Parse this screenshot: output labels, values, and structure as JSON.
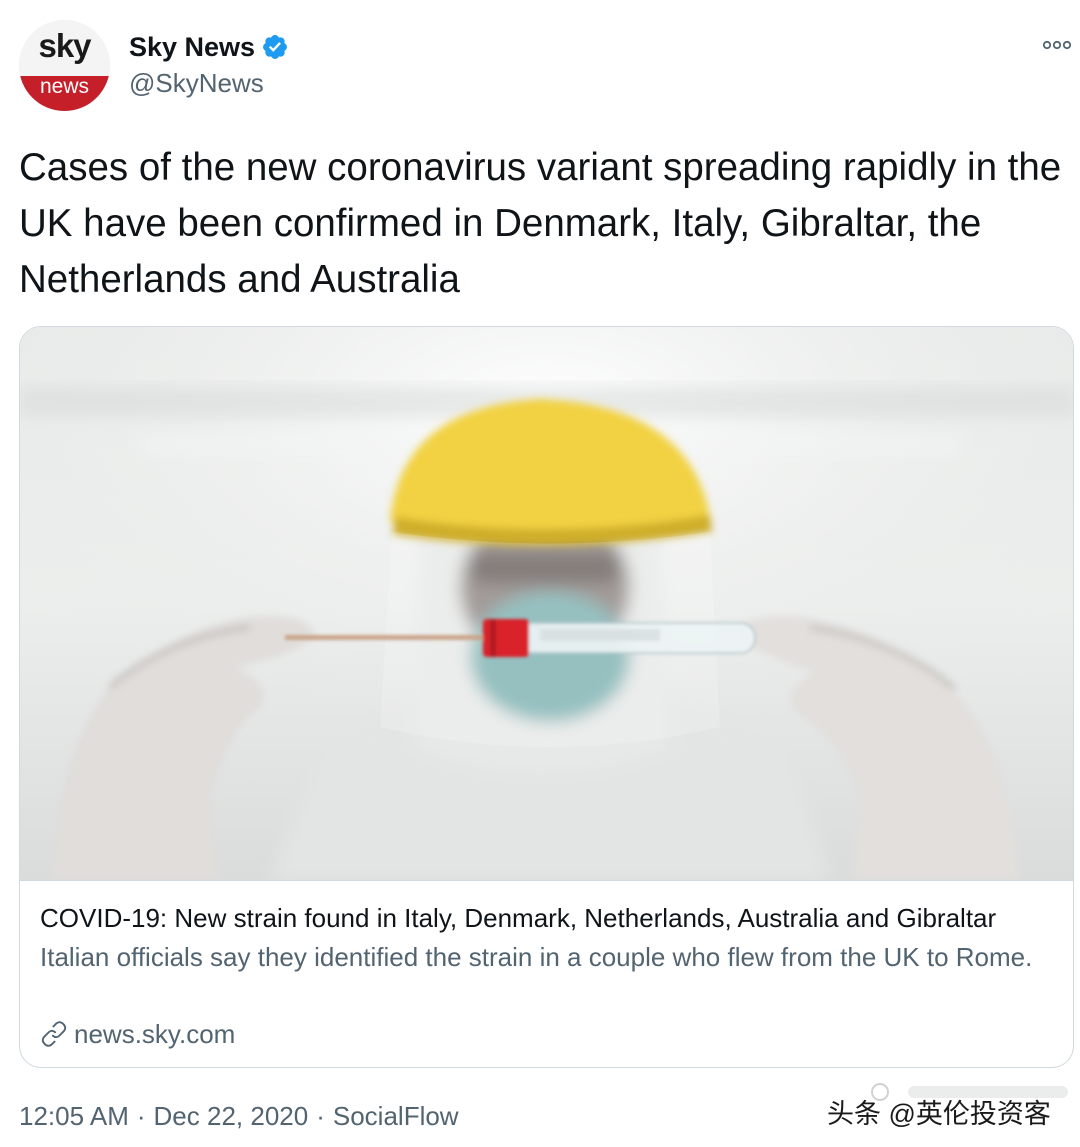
{
  "tweet": {
    "author": {
      "avatar_top": "sky",
      "avatar_bottom": "news",
      "display_name": "Sky News",
      "handle": "@SkyNews",
      "verified_icon": "verified-badge-icon"
    },
    "more_icon": "more-options-icon",
    "text": "Cases of the new coronavirus variant spreading rapidly in the UK have been confirmed in Denmark, Italy, Gibraltar, the Netherlands and Australia",
    "card": {
      "image_description_icon": "photo",
      "title": "COVID-19: New strain found in Italy, Denmark, Netherlands, Australia and Gibraltar",
      "description": "Italian officials say they identified the strain in a couple who flew from the UK to Rome.",
      "domain": "news.sky.com",
      "link_icon": "link-icon"
    },
    "meta": {
      "time": "12:05 AM",
      "separator": "·",
      "date": "Dec 22, 2020",
      "source": "SocialFlow"
    }
  },
  "watermark": {
    "text": "头条 @英伦投资客"
  },
  "colors": {
    "text_primary": "#0f1419",
    "text_secondary": "#536471",
    "border": "#cfd9de",
    "verified": "#1d9bf0",
    "sky_red": "#c51f2a"
  }
}
